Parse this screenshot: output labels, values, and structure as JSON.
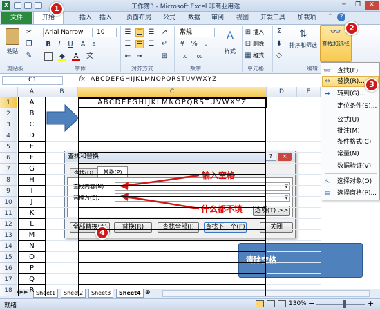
{
  "window": {
    "title": "工作簿3 - Microsoft Excel 非商业用途"
  },
  "tabs": [
    "文件",
    "开始",
    "插入",
    "页面布局",
    "公式",
    "数据",
    "审阅",
    "视图",
    "开发工具",
    "加载项"
  ],
  "tab_home_partial": "开始",
  "tab_insert_partial": "页面布局",
  "ribbon": {
    "paste_label": "粘贴",
    "clipboard_group": "剪贴板",
    "font_name": "Arial Narrow",
    "font_size": "10",
    "font_group": "字体",
    "align_group": "对齐方式",
    "number_format": "常规",
    "number_group": "数字",
    "style_label": "样式",
    "insert_label": "插入",
    "delete_label": "删除",
    "format_label": "格式",
    "cells_group": "单元格",
    "sort_filter_label": "排序和筛选",
    "find_select_label": "查找和选择",
    "edit_group": "编辑",
    "bold": "B",
    "italic": "I",
    "underline": "U",
    "font_a": "A",
    "sum": "Σ",
    "percent": "%",
    "comma": ","
  },
  "formula_bar": {
    "name_box": "C1",
    "fx": "fx",
    "value": "ABCDEFGHIJKLMNOPQRSTUVWXYZ"
  },
  "columns": [
    "A",
    "B",
    "C",
    "D",
    "E"
  ],
  "rows": [
    "1",
    "2",
    "3",
    "4",
    "5",
    "6",
    "7",
    "8",
    "9",
    "10",
    "11",
    "12",
    "13",
    "14",
    "15",
    "16",
    "17",
    "18"
  ],
  "col_a_values": [
    "A",
    "B",
    "C",
    "D",
    "E",
    "F",
    "G",
    "H",
    "I",
    "J",
    "K",
    "L",
    "M",
    "N",
    "O",
    "P",
    "Q",
    "R"
  ],
  "c1_value": "ABCDEFGHIJKLMNOPQRSTUVWXYZ",
  "find_menu": {
    "items": [
      "查找(F)...",
      "替换(R)...",
      "转到(G)...",
      "定位条件(S)...",
      "公式(U)",
      "批注(M)",
      "条件格式(C)",
      "常量(N)",
      "数据验证(V)",
      "选择对象(O)",
      "选择窗格(P)..."
    ]
  },
  "dialog": {
    "title": "查找和替换",
    "tab_find": "查找(D)",
    "tab_replace": "替换(P)",
    "find_label": "查找内容(N):",
    "replace_label": "替换为(E):",
    "options_button": "选项(T) >>",
    "replace_all": "全部替换(A)",
    "replace": "替换(R)",
    "find_all": "查找全部(I)",
    "find_next": "查找下一个(F)",
    "close": "关闭",
    "help": "?",
    "x": "×"
  },
  "annotations": {
    "input_space": "输入空格",
    "leave_empty": "什么都不填",
    "clear_spaces": "清除空格",
    "badges": [
      "1",
      "2",
      "3",
      "4"
    ]
  },
  "sheets": [
    "Sheet1",
    "Sheet2",
    "Sheet3",
    "Sheet4"
  ],
  "status": {
    "ready": "就绪",
    "zoom": "130%",
    "minus": "−",
    "plus": "+"
  },
  "colors": {
    "file_tab": "#2a8a3e",
    "badge": "#d01a1a",
    "arrow": "#d01a1a",
    "blue_arrow": "#4f81bd",
    "callout_box": "#4f81bd"
  }
}
